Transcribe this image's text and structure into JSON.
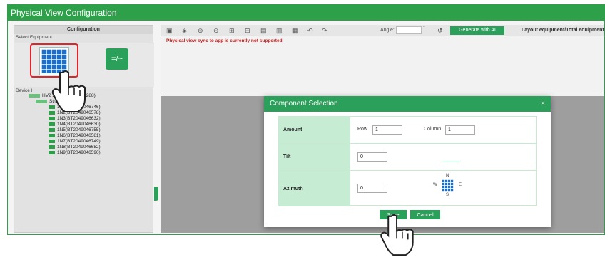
{
  "window": {
    "title": "Physical View Configuration"
  },
  "left_panel": {
    "header": "Configuration",
    "select_label": "Select Equipment",
    "device_label": "Device l",
    "tree": {
      "root": "HV2      288(HV2040052288)",
      "string": "String1",
      "items": [
        "1N1(BT2049046746)",
        "1N2(BT2049046578)",
        "1N3(BT2049046632)",
        "1N4(BT2049046630)",
        "1N5(BT2049046755)",
        "1N6(BT2049046581)",
        "1N7(BT2049046749)",
        "1N8(BT2049046682)",
        "1N9(BT2049046590)"
      ]
    },
    "inverter_symbol": "=/~"
  },
  "toolbar": {
    "angle_label": "Angle:",
    "angle_value": "",
    "degree": "°",
    "generate_label": "Generate with AI",
    "layout_label": "Layout equipment/Total equipment",
    "warning": "Physical view sync to app is currently not supported"
  },
  "dialog": {
    "title": "Component Selection",
    "close": "×",
    "amount_label": "Amount",
    "row_label": "Row",
    "row_value": "1",
    "column_label": "Column",
    "column_value": "1",
    "tilt_label": "Tilt",
    "tilt_value": "0",
    "azimuth_label": "Azimuth",
    "azimuth_value": "0",
    "compass": {
      "n": "N",
      "s": "S",
      "w": "W",
      "e": "E"
    },
    "save_label": "Save",
    "cancel_label": "Cancel"
  },
  "colors": {
    "brand_green": "#2aa05a",
    "highlight_red": "#e0242a",
    "warning_red": "#cc1c1c",
    "panel_blue": "#1d6ec8"
  }
}
